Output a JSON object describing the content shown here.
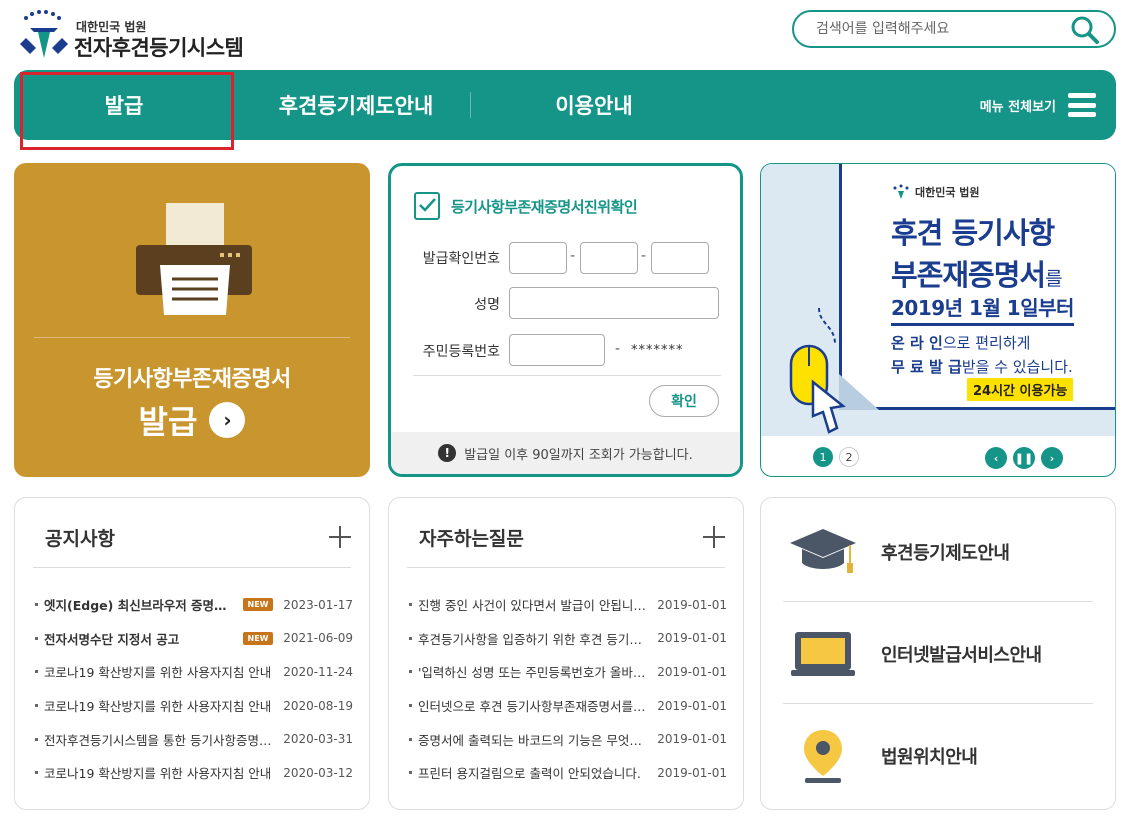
{
  "header": {
    "court_label": "대한민국 법원",
    "site_title": "전자후견등기시스템",
    "search_placeholder": "검색어를 입력해주세요"
  },
  "nav": {
    "items": [
      {
        "label": "발급"
      },
      {
        "label": "후견등기제도안내"
      },
      {
        "label": "이용안내"
      }
    ],
    "menu_all_label": "메뉴 전체보기",
    "highlighted_item": "발급"
  },
  "issue_card": {
    "title": "등기사항부존재증명서",
    "action_label": "발급"
  },
  "verify": {
    "title": "등기사항부존재증명서진위확인",
    "issue_number_label": "발급확인번호",
    "name_label": "성명",
    "resident_number_label": "주민등록번호",
    "dash": "-",
    "masked_suffix": "*******",
    "confirm_label": "확인",
    "footer_notice": "발급일 이후 90일까지 조회가 가능합니다."
  },
  "banner": {
    "court_label": "대한민국 법원",
    "line1": "후견 등기사항",
    "line2": "부존재증명서",
    "line2_suffix": "를",
    "date_text": "2019년 1월 1일부터",
    "text1_bold": "온 라 인",
    "text1_rest": "으로 편리하게",
    "text2_bold": "무 료 발 급",
    "text2_rest": "받을 수 있습니다.",
    "hours_badge": "24시간 이용가능",
    "pages": [
      "1",
      "2"
    ],
    "active_page": "1"
  },
  "notices": {
    "title": "공지사항",
    "new_badge": "NEW",
    "items": [
      {
        "title": "엣지(Edge) 최신브라우저 증명서 발급 관련 안내",
        "date": "2023-01-17",
        "is_new": true
      },
      {
        "title": "전자서명수단 지정서 공고",
        "date": "2021-06-09",
        "is_new": true
      },
      {
        "title": "코로나19 확산방지를 위한 사용자지침 안내",
        "date": "2020-11-24",
        "is_new": false
      },
      {
        "title": "코로나19 확산방지를 위한 사용자지침 안내",
        "date": "2020-08-19",
        "is_new": false
      },
      {
        "title": "전자후견등기시스템을 통한 등기사항증명서 발급 안내",
        "date": "2020-03-31",
        "is_new": false
      },
      {
        "title": "코로나19 확산방지를 위한 사용자지침 안내",
        "date": "2020-03-12",
        "is_new": false
      }
    ]
  },
  "faq": {
    "title": "자주하는질문",
    "items": [
      {
        "title": "진행 중인 사건이 있다면서 발급이 안됩니다.",
        "date": "2019-01-01"
      },
      {
        "title": "후견등기사항을 입증하기 위한 후견 등기사항증명서는",
        "date": "2019-01-01"
      },
      {
        "title": "'입력하신 성명 또는 주민등록번호가 올바르지 않습니다'",
        "date": "2019-01-01"
      },
      {
        "title": "인터넷으로 후견 등기사항부존재증명서를 발급받으려면",
        "date": "2019-01-01"
      },
      {
        "title": "증명서에 출력되는 바코드의 기능은 무엇인가요?",
        "date": "2019-01-01"
      },
      {
        "title": "프린터 용지걸림으로 출력이 안되었습니다.",
        "date": "2019-01-01"
      }
    ]
  },
  "quick_links": [
    {
      "label": "후견등기제도안내",
      "icon": "graduation-cap-icon"
    },
    {
      "label": "인터넷발급서비스안내",
      "icon": "monitor-icon"
    },
    {
      "label": "법원위치안내",
      "icon": "location-pin-icon"
    }
  ],
  "colors": {
    "primary": "#159488",
    "issue_card": "#c8952f",
    "highlight_box": "#d9232e",
    "banner_navy": "#1a3d8f",
    "new_badge": "#c8741b"
  }
}
